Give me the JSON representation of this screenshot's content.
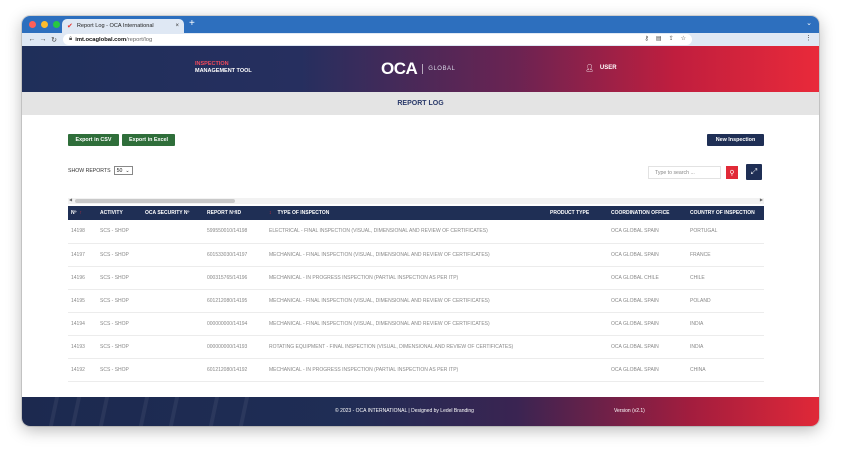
{
  "browser": {
    "tab_title": "Report Log - OCA International",
    "tab_close": "×",
    "new_tab": "+",
    "url_host": "imt.ocaglobal.com",
    "url_path": "/report/log"
  },
  "header": {
    "brand_line1": "INSPECTION",
    "brand_line2": "MANAGEMENT TOOL",
    "logo_text": "OCA",
    "logo_sub": "GLOBAL",
    "user_label": "USER"
  },
  "page": {
    "title": "REPORT LOG"
  },
  "toolbar": {
    "export_csv": "Export in CSV",
    "export_excel": "Export in Excel",
    "new_inspection": "New Inspection",
    "show_label": "SHOW REPORTS",
    "show_value": "50",
    "search_placeholder": "Type to search ..."
  },
  "table": {
    "columns": [
      "Nº",
      "ACTIVITY",
      "OCA SECURITY Nº",
      "REPORT Nº/ID",
      "TYPE OF INSPECTON",
      "PRODUCT TYPE",
      "COORDINATION OFFICE",
      "COUNTRY OF INSPECTION"
    ],
    "rows": [
      [
        "14198",
        "SCS - SHOP",
        "",
        "599550010/14198",
        "ELECTRICAL - FINAL INSPECTION (VISUAL, DIMENSIONAL AND REVIEW OF CERTIFICATES)",
        "",
        "OCA GLOBAL SPAIN",
        "PORTUGAL"
      ],
      [
        "14197",
        "SCS - SHOP",
        "",
        "601533030/14197",
        "MECHANICAL - FINAL INSPECTION (VISUAL, DIMENSIONAL AND REVIEW OF CERTIFICATES)",
        "",
        "OCA GLOBAL SPAIN",
        "FRANCE"
      ],
      [
        "14196",
        "SCS - SHOP",
        "",
        "000315765/14196",
        "MECHANICAL - IN PROGRESS INSPECTION (PARTIAL INSPECTION AS PER ITP)",
        "",
        "OCA GLOBAL CHILE",
        "CHILE"
      ],
      [
        "14195",
        "SCS - SHOP",
        "",
        "601212080/14195",
        "MECHANICAL - FINAL INSPECTION (VISUAL, DIMENSIONAL AND REVIEW OF CERTIFICATES)",
        "",
        "OCA GLOBAL SPAIN",
        "POLAND"
      ],
      [
        "14194",
        "SCS - SHOP",
        "",
        "000000000/14194",
        "MECHANICAL - FINAL INSPECTION (VISUAL, DIMENSIONAL AND REVIEW OF CERTIFICATES)",
        "",
        "OCA GLOBAL SPAIN",
        "INDIA"
      ],
      [
        "14193",
        "SCS - SHOP",
        "",
        "000000000/14193",
        "ROTATING EQUIPMENT - FINAL INSPECTION (VISUAL, DIMENSIONAL AND REVIEW OF CERTIFICATES)",
        "",
        "OCA GLOBAL SPAIN",
        "INDIA"
      ],
      [
        "14192",
        "SCS - SHOP",
        "",
        "601212080/14192",
        "MECHANICAL - IN PROGRESS INSPECTION (PARTIAL INSPECTION AS PER ITP)",
        "",
        "OCA GLOBAL SPAIN",
        "CHINA"
      ]
    ]
  },
  "footer": {
    "copyright": "© 2023 - OCA INTERNATIONAL | Designed by Ledel Branding",
    "version": "Version (v2.1)"
  },
  "icons": {
    "favicon": "check-icon",
    "user": "person-icon",
    "search": "search-icon",
    "expand": "expand-icon"
  },
  "colors": {
    "navy": "#1f2f55",
    "brand_red": "#e12a38",
    "export_green": "#2f6e3a",
    "chrome_blue": "#2d6fbe"
  }
}
